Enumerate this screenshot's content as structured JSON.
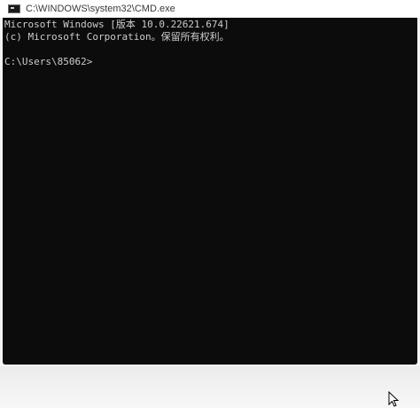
{
  "window": {
    "title": "C:\\WINDOWS\\system32\\CMD.exe",
    "icon": "cmd-icon"
  },
  "console": {
    "lines": [
      "Microsoft Windows [版本 10.0.22621.674]",
      "(c) Microsoft Corporation。保留所有权利。",
      "",
      "C:\\Users\\85062>"
    ],
    "background": "#0c0c0c",
    "foreground": "#cccccc"
  },
  "pointer": {
    "icon": "mouse-pointer-icon"
  }
}
